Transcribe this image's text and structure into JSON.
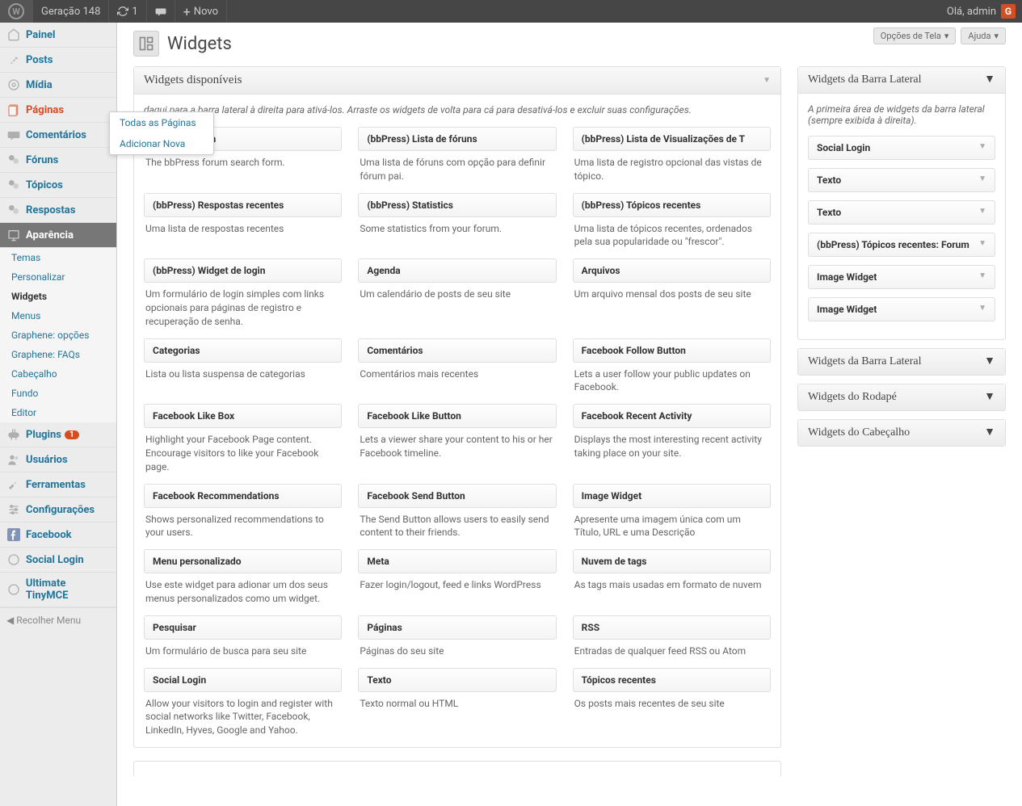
{
  "toolbar": {
    "site_name": "Geração 148",
    "refresh_count": "1",
    "new_label": "Novo",
    "greeting": "Olá, admin",
    "avatar_letter": "G"
  },
  "head_actions": {
    "screen_options": "Opções de Tela",
    "help": "Ajuda"
  },
  "page_title": "Widgets",
  "menu": {
    "dashboard": "Painel",
    "posts": "Posts",
    "media": "Mídia",
    "pages": "Páginas",
    "comments": "Comentários",
    "forums": "Fóruns",
    "topics": "Tópicos",
    "replies": "Respostas",
    "appearance": "Aparência",
    "plugins": "Plugins",
    "plugins_count": "1",
    "users": "Usuários",
    "tools": "Ferramentas",
    "settings": "Configurações",
    "facebook": "Facebook",
    "social_login": "Social Login",
    "ultimate_tinymce": "Ultimate TinyMCE",
    "collapse": "Recolher Menu"
  },
  "flyout": {
    "all_pages": "Todas as Páginas",
    "add_new": "Adicionar Nova"
  },
  "appearance_submenu": {
    "themes": "Temas",
    "customize": "Personalizar",
    "widgets": "Widgets",
    "menus": "Menus",
    "graphene_options": "Graphene: opções",
    "graphene_faqs": "Graphene: FAQs",
    "header": "Cabeçalho",
    "background": "Fundo",
    "editor": "Editor"
  },
  "available": {
    "title": "Widgets disponíveis",
    "desc_prefix": "daqui para a barra lateral à direita para ativá-los. Arraste os widgets de volta para cá para desativá-los e excluir suas configurações.",
    "widgets": [
      {
        "title": "n Search Form",
        "desc": "The bbPress forum search form."
      },
      {
        "title": "(bbPress) Lista de fóruns",
        "desc": "Uma lista de fóruns com opção para definir fórum pai."
      },
      {
        "title": "(bbPress) Lista de Visualizações de T",
        "desc": "Uma lista de registro opcional das vistas de tópico."
      },
      {
        "title": "(bbPress) Respostas recentes",
        "desc": "Uma lista de respostas recentes"
      },
      {
        "title": "(bbPress) Statistics",
        "desc": "Some statistics from your forum."
      },
      {
        "title": "(bbPress) Tópicos recentes",
        "desc": "Uma lista de tópicos recentes, ordenados pela sua popularidade ou \"frescor\"."
      },
      {
        "title": "(bbPress) Widget de login",
        "desc": "Um formulário de login simples com links opcionais para páginas de registro e recuperação de senha."
      },
      {
        "title": "Agenda",
        "desc": "Um calendário de posts de seu site"
      },
      {
        "title": "Arquivos",
        "desc": "Um arquivo mensal dos posts de seu site"
      },
      {
        "title": "Categorias",
        "desc": "Lista ou lista suspensa de categorias"
      },
      {
        "title": "Comentários",
        "desc": "Comentários mais recentes"
      },
      {
        "title": "Facebook Follow Button",
        "desc": "Lets a user follow your public updates on Facebook."
      },
      {
        "title": "Facebook Like Box",
        "desc": "Highlight your Facebook Page content. Encourage visitors to like your Facebook page."
      },
      {
        "title": "Facebook Like Button",
        "desc": "Lets a viewer share your content to his or her Facebook timeline."
      },
      {
        "title": "Facebook Recent Activity",
        "desc": "Displays the most interesting recent activity taking place on your site."
      },
      {
        "title": "Facebook Recommendations",
        "desc": "Shows personalized recommendations to your users."
      },
      {
        "title": "Facebook Send Button",
        "desc": "The Send Button allows users to easily send content to their friends."
      },
      {
        "title": "Image Widget",
        "desc": "Apresente uma imagem única com um Título, URL e uma Descrição"
      },
      {
        "title": "Menu personalizado",
        "desc": "Use este widget para adionar um dos seus menus personalizados como um widget."
      },
      {
        "title": "Meta",
        "desc": "Fazer login/logout, feed e links WordPress"
      },
      {
        "title": "Nuvem de tags",
        "desc": "As tags mais usadas em formato de nuvem"
      },
      {
        "title": "Pesquisar",
        "desc": "Um formulário de busca para seu site"
      },
      {
        "title": "Páginas",
        "desc": "Páginas do seu site"
      },
      {
        "title": "RSS",
        "desc": "Entradas de qualquer feed RSS ou Atom"
      },
      {
        "title": "Social Login",
        "desc": "Allow your visitors to login and register with social networks like Twitter, Facebook, LinkedIn, Hyves, Google and Yahoo."
      },
      {
        "title": "Texto",
        "desc": "Texto normal ou HTML"
      },
      {
        "title": "Tópicos recentes",
        "desc": "Os posts mais recentes de seu site"
      }
    ]
  },
  "sidebar_areas": {
    "area1": {
      "title": "Widgets da Barra Lateral",
      "desc": "A primeira área de widgets da barra lateral (sempre exibida à direita).",
      "placed": [
        "Social Login",
        "Texto",
        "Texto",
        "(bbPress) Tópicos recentes: Forum",
        "Image Widget",
        "Image Widget"
      ]
    },
    "area2": {
      "title": "Widgets da Barra Lateral"
    },
    "area3": {
      "title": "Widgets do Rodapé"
    },
    "area4": {
      "title": "Widgets do Cabeçalho"
    }
  }
}
